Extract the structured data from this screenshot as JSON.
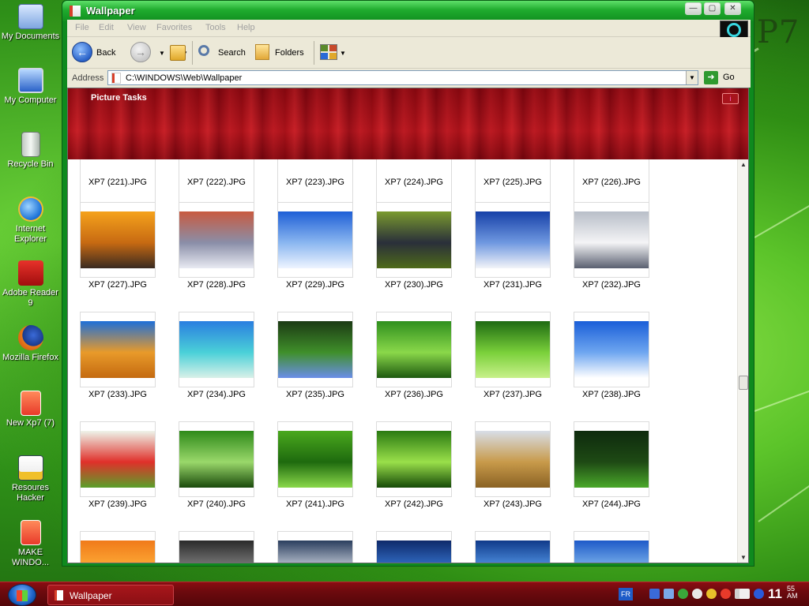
{
  "desktop": {
    "brand_text": "P7",
    "icons": [
      {
        "label": "My Documents",
        "icon": "folder-documents-icon"
      },
      {
        "label": "My Computer",
        "icon": "computer-icon"
      },
      {
        "label": "Recycle Bin",
        "icon": "recycle-bin-icon"
      },
      {
        "label": "Internet Explorer",
        "icon": "internet-explorer-icon"
      },
      {
        "label": "Adobe Reader 9",
        "icon": "adobe-reader-icon"
      },
      {
        "label": "Mozilla Firefox",
        "icon": "firefox-icon"
      },
      {
        "label": "New Xp7 (7)",
        "icon": "document-icon"
      },
      {
        "label": "Resoures Hacker",
        "icon": "resource-hacker-icon"
      },
      {
        "label": "MAKE WINDO...",
        "icon": "document-icon"
      }
    ]
  },
  "window": {
    "title": "Wallpaper",
    "controls": {
      "minimize": "—",
      "maximize": "▢",
      "close": "✕"
    },
    "menu": [
      "File",
      "Edit",
      "View",
      "Favorites",
      "Tools",
      "Help"
    ],
    "toolbar": {
      "back": "Back",
      "search": "Search",
      "folders": "Folders"
    },
    "address": {
      "label": "Address",
      "path": "C:\\WINDOWS\\Web\\Wallpaper",
      "go": "Go"
    },
    "tasks_title": "Picture Tasks",
    "top_partial_row": [
      "XP7 (221).JPG",
      "XP7 (222).JPG",
      "XP7 (223).JPG",
      "XP7 (224).JPG",
      "XP7 (225).JPG",
      "XP7 (226).JPG"
    ],
    "rows": [
      [
        {
          "name": "XP7 (227).JPG",
          "colors": [
            "#f5a21c",
            "#c76a12",
            "#3a2a20"
          ]
        },
        {
          "name": "XP7 (228).JPG",
          "colors": [
            "#c85a40",
            "#8a8ea8",
            "#e8eaf2"
          ]
        },
        {
          "name": "XP7 (229).JPG",
          "colors": [
            "#1e5fd6",
            "#8ab6f0",
            "#eef4ff"
          ]
        },
        {
          "name": "XP7 (230).JPG",
          "colors": [
            "#7a9a2e",
            "#2a2f3a",
            "#4e6a1a"
          ]
        },
        {
          "name": "XP7 (231).JPG",
          "colors": [
            "#1640a8",
            "#6f98e0",
            "#f2f4f8"
          ]
        },
        {
          "name": "XP7 (232).JPG",
          "colors": [
            "#b8bec8",
            "#f4f4f6",
            "#5a6070"
          ]
        }
      ],
      [
        {
          "name": "XP7 (233).JPG",
          "colors": [
            "#1e6fd8",
            "#e89a2a",
            "#c46a10"
          ]
        },
        {
          "name": "XP7 (234).JPG",
          "colors": [
            "#2a7ee0",
            "#4ad0d8",
            "#d8f0e8"
          ]
        },
        {
          "name": "XP7 (235).JPG",
          "colors": [
            "#1c3a14",
            "#3f8f2a",
            "#6a8ee8"
          ]
        },
        {
          "name": "XP7 (236).JPG",
          "colors": [
            "#2f8f1e",
            "#8ad84a",
            "#1e5a10"
          ]
        },
        {
          "name": "XP7 (237).JPG",
          "colors": [
            "#1e6a12",
            "#7ad03a",
            "#c8f08a"
          ]
        },
        {
          "name": "XP7 (238).JPG",
          "colors": [
            "#1a5ed8",
            "#6ea6f0",
            "#ffffff"
          ]
        }
      ],
      [
        {
          "name": "XP7 (239).JPG",
          "colors": [
            "#eef4ea",
            "#e0302a",
            "#5aa02a"
          ]
        },
        {
          "name": "XP7 (240).JPG",
          "colors": [
            "#2e8a1a",
            "#9ad86a",
            "#1a4a0c"
          ]
        },
        {
          "name": "XP7 (241).JPG",
          "colors": [
            "#4aa81e",
            "#1e6a0e",
            "#8ad84a"
          ]
        },
        {
          "name": "XP7 (242).JPG",
          "colors": [
            "#2a7a12",
            "#9ae04a",
            "#164a08"
          ]
        },
        {
          "name": "XP7 (243).JPG",
          "colors": [
            "#d8dee8",
            "#c89a4a",
            "#8a6224"
          ]
        },
        {
          "name": "XP7 (244).JPG",
          "colors": [
            "#0e2a0e",
            "#1e4a14",
            "#4aa82a"
          ]
        }
      ],
      [
        {
          "name": "",
          "colors": [
            "#f07a1a",
            "#ffb23a",
            "#c84a10"
          ]
        },
        {
          "name": "",
          "colors": [
            "#2a2a2a",
            "#8a8a8a",
            "#505050"
          ]
        },
        {
          "name": "",
          "colors": [
            "#2a3e5e",
            "#d8dee8",
            "#4a5a78"
          ]
        },
        {
          "name": "",
          "colors": [
            "#0e2a6a",
            "#3a7ad8",
            "#6aa8f0"
          ]
        },
        {
          "name": "",
          "colors": [
            "#103a8a",
            "#5aa0f0",
            "#a8d0ff"
          ]
        },
        {
          "name": "",
          "colors": [
            "#1e5ac8",
            "#8ac0f0",
            "#3a7a2a"
          ]
        }
      ]
    ]
  },
  "taskbar": {
    "task_label": "Wallpaper",
    "language": "FR",
    "clock": "11",
    "clock_min": "55",
    "clock_ampm": "AM"
  }
}
